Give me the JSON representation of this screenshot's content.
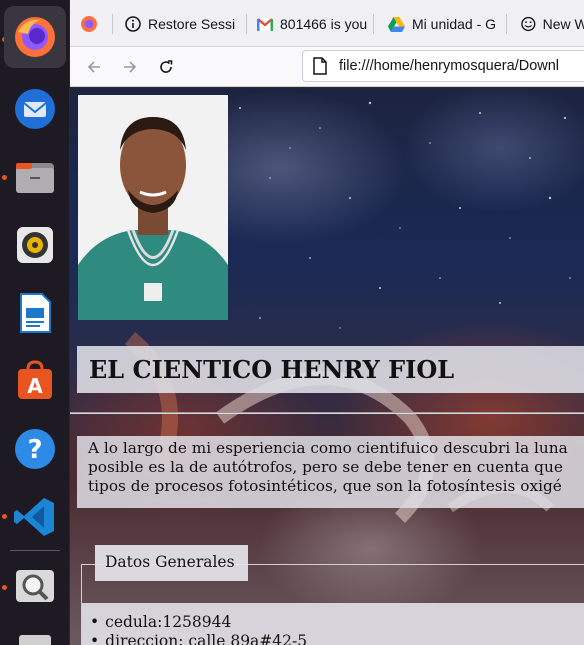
{
  "browser": {
    "tabs": [
      {
        "label": "",
        "icon": "firefox-icon"
      },
      {
        "label": "Restore Sessi",
        "icon": "info-icon"
      },
      {
        "label": "801466 is you",
        "icon": "gmail-icon"
      },
      {
        "label": "Mi unidad - G",
        "icon": "google-drive-icon"
      },
      {
        "label": "New W",
        "icon": "smiley-icon"
      }
    ],
    "url": "file:///home/henrymosquera/Downl"
  },
  "dock": {
    "apps": [
      {
        "name": "firefox",
        "icon": "firefox-icon",
        "active": true
      },
      {
        "name": "thunderbird",
        "icon": "thunderbird-icon"
      },
      {
        "name": "files",
        "icon": "files-icon"
      },
      {
        "name": "rhythmbox",
        "icon": "rhythmbox-icon"
      },
      {
        "name": "libreoffice-writer",
        "icon": "writer-icon"
      },
      {
        "name": "software",
        "icon": "app-store-icon"
      },
      {
        "name": "help",
        "icon": "help-icon"
      },
      {
        "name": "vscode",
        "icon": "vscode-icon"
      },
      {
        "name": "image-viewer",
        "icon": "search-icon"
      }
    ],
    "accent": "#e95420"
  },
  "page": {
    "title": "EL CIENTICO HENRY FIOL",
    "paragraph_lines": [
      "A lo largo de mi esperiencia como cientifuico descubri la luna",
      "posible es la de autótrofos, pero se debe tener en cuenta que",
      "tipos de procesos fotosintéticos, que son la fotosíntesis oxigé"
    ],
    "legend": "Datos Generales",
    "list_items": [
      "cedula:1258944",
      "direccion: calle 89a#42-5"
    ]
  }
}
